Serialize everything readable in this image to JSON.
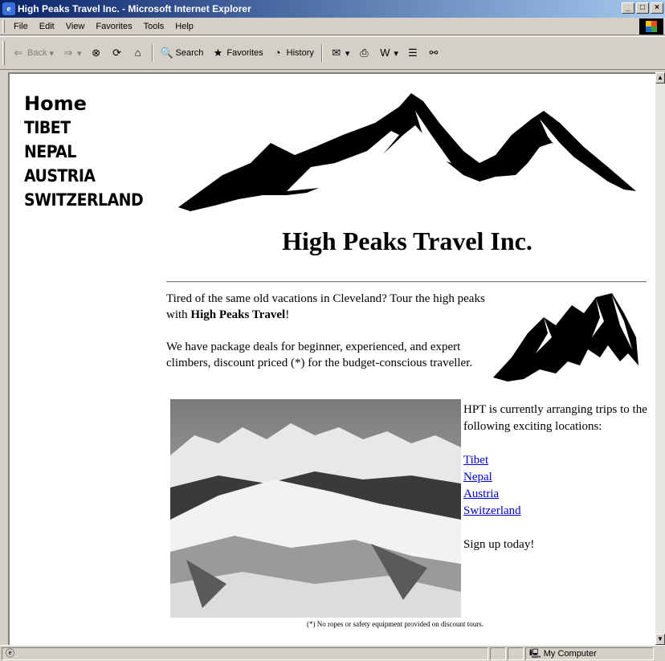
{
  "window": {
    "title": "High Peaks Travel Inc. - Microsoft Internet Explorer"
  },
  "menu": [
    "File",
    "Edit",
    "View",
    "Favorites",
    "Tools",
    "Help"
  ],
  "toolbar": {
    "back": "Back",
    "search": "Search",
    "favorites": "Favorites",
    "history": "History"
  },
  "nav": {
    "home": "Home",
    "items": [
      "TIBET",
      "NEPAL",
      "AUSTRIA",
      "SWITZERLAND"
    ]
  },
  "page": {
    "title": "High Peaks Travel Inc.",
    "intro1_pre": "Tired of the same old vacations in Cleveland? Tour the high peaks with ",
    "intro1_bold": "High Peaks Travel",
    "intro1_post": "!",
    "intro2": "We have package deals for beginner, experienced, and expert climbers, discount priced (*) for the budget-conscious traveller.",
    "locations_intro": "HPT is currently arranging trips to the following exciting locations:",
    "links": [
      "Tibet",
      "Nepal",
      "Austria",
      "Switzerland"
    ],
    "signup": "Sign up today!",
    "footnote": "(*) No ropes or safety equipment provided on discount tours."
  },
  "status": {
    "zone": "My Computer"
  }
}
